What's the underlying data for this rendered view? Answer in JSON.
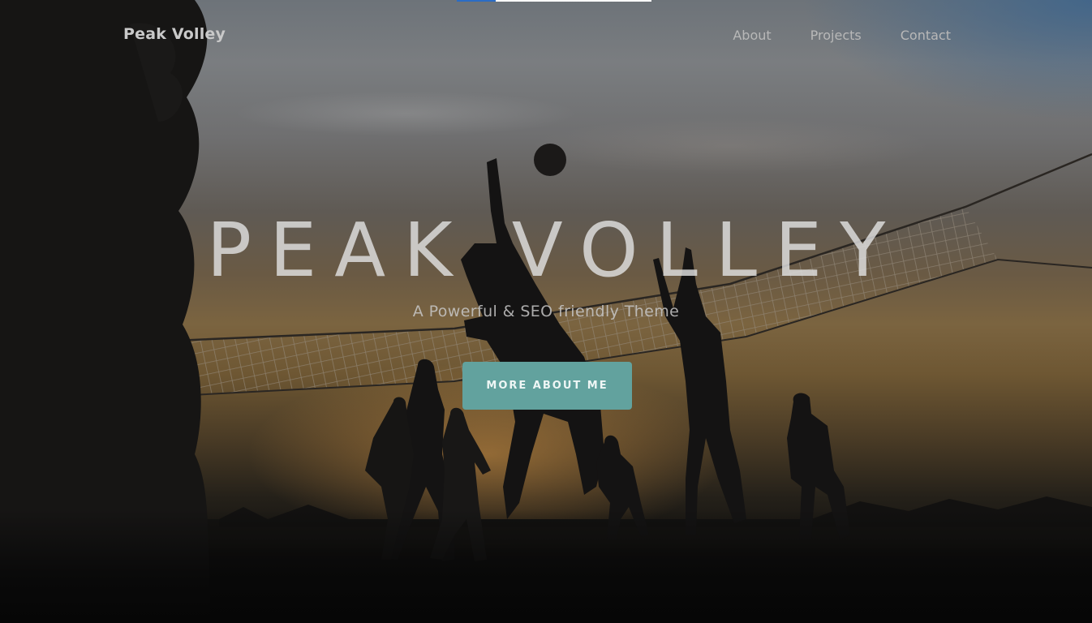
{
  "page": {
    "progress": 0.2
  },
  "nav": {
    "brand": "Peak Volley",
    "items": [
      {
        "label": "About"
      },
      {
        "label": "Projects"
      },
      {
        "label": "Contact"
      }
    ]
  },
  "hero": {
    "title": "PEAK VOLLEY",
    "subtitle": "A Powerful & SEO friendly Theme",
    "cta_label": "MORE ABOUT ME",
    "background_image": "silhouettes-playing-beach-volleyball-at-sunset"
  },
  "colors": {
    "accent": "#62a29e",
    "progress_fill": "#2b6cc4"
  }
}
